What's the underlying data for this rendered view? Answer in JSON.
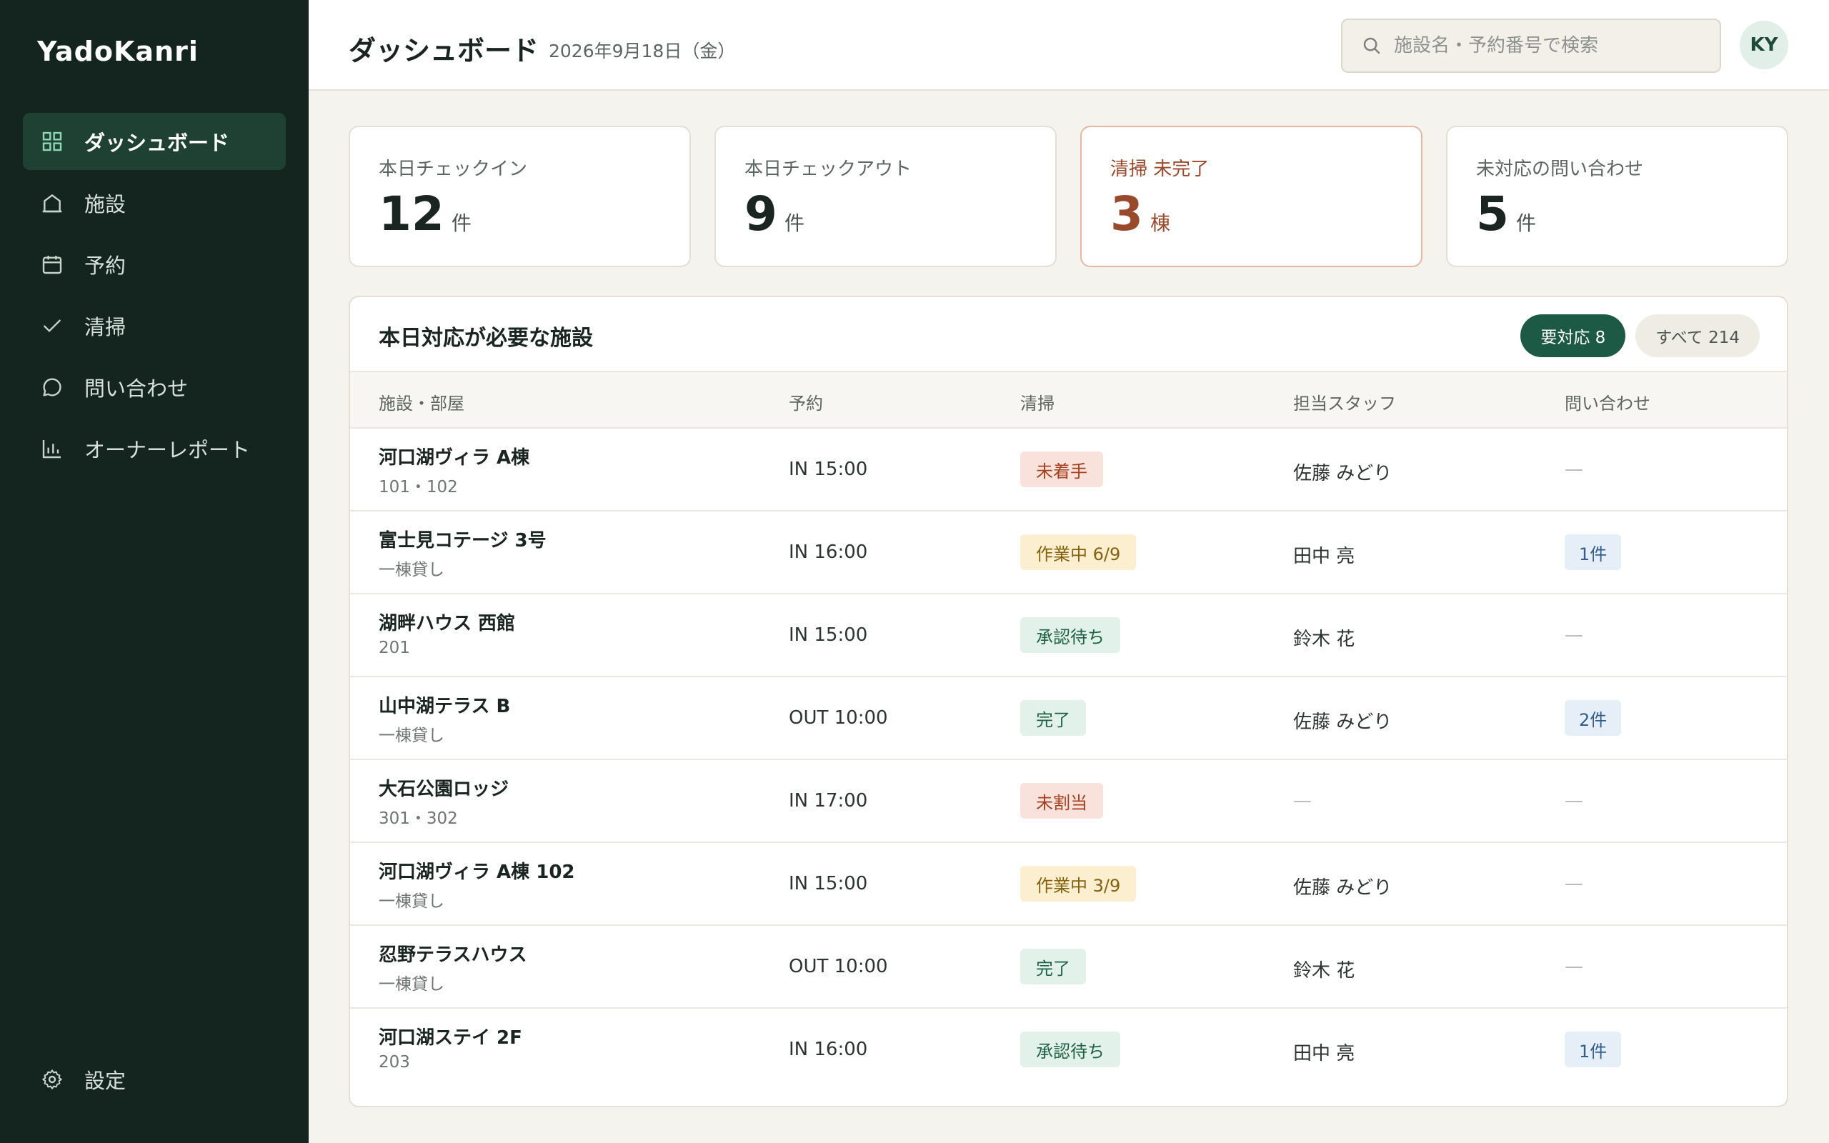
{
  "app": {
    "name": "YadoKanri"
  },
  "sidebar": {
    "items": [
      {
        "label": "ダッシュボード",
        "icon": "dashboard-icon",
        "active": true
      },
      {
        "label": "施設",
        "icon": "home-icon",
        "active": false
      },
      {
        "label": "予約",
        "icon": "calendar-icon",
        "active": false
      },
      {
        "label": "清掃",
        "icon": "check-icon",
        "active": false
      },
      {
        "label": "問い合わせ",
        "icon": "chat-icon",
        "active": false
      },
      {
        "label": "オーナーレポート",
        "icon": "bar-chart-icon",
        "active": false
      }
    ],
    "settings_label": "設定"
  },
  "header": {
    "title": "ダッシュボード",
    "date": "2026年9月18日（金）",
    "search_placeholder": "施設名・予約番号で検索",
    "avatar_initials": "KY"
  },
  "stats": [
    {
      "label": "本日チェックイン",
      "value": "12",
      "unit": "件",
      "alert": false
    },
    {
      "label": "本日チェックアウト",
      "value": "9",
      "unit": "件",
      "alert": false
    },
    {
      "label": "清掃 未完了",
      "value": "3",
      "unit": "棟",
      "alert": true
    },
    {
      "label": "未対応の問い合わせ",
      "value": "5",
      "unit": "件",
      "alert": false
    }
  ],
  "panel": {
    "title": "本日対応が必要な施設",
    "filters": {
      "active": "要対応 8",
      "all": "すべて 214"
    },
    "columns": [
      "施設・部屋",
      "予約",
      "清掃",
      "担当スタッフ",
      "問い合わせ"
    ],
    "rows": [
      {
        "name": "河口湖ヴィラ A棟",
        "sub": "101・102",
        "reserve": "IN 15:00",
        "cleaning": "未着手",
        "cleaning_tone": "red",
        "staff": "佐藤 みどり",
        "inquiry": "—"
      },
      {
        "name": "富士見コテージ 3号",
        "sub": "一棟貸し",
        "reserve": "IN 16:00",
        "cleaning": "作業中 6/9",
        "cleaning_tone": "yellow",
        "staff": "田中 亮",
        "inquiry": "1件"
      },
      {
        "name": "湖畔ハウス 西館",
        "sub": "201",
        "reserve": "IN 15:00",
        "cleaning": "承認待ち",
        "cleaning_tone": "green",
        "staff": "鈴木 花",
        "inquiry": "—"
      },
      {
        "name": "山中湖テラス B",
        "sub": "一棟貸し",
        "reserve": "OUT 10:00",
        "cleaning": "完了",
        "cleaning_tone": "green",
        "staff": "佐藤 みどり",
        "inquiry": "2件"
      },
      {
        "name": "大石公園ロッジ",
        "sub": "301・302",
        "reserve": "IN 17:00",
        "cleaning": "未割当",
        "cleaning_tone": "red",
        "staff": "—",
        "inquiry": "—"
      },
      {
        "name": "河口湖ヴィラ A棟 102",
        "sub": "一棟貸し",
        "reserve": "IN 15:00",
        "cleaning": "作業中 3/9",
        "cleaning_tone": "yellow",
        "staff": "佐藤 みどり",
        "inquiry": "—"
      },
      {
        "name": "忍野テラスハウス",
        "sub": "一棟貸し",
        "reserve": "OUT 10:00",
        "cleaning": "完了",
        "cleaning_tone": "green",
        "staff": "鈴木 花",
        "inquiry": "—"
      },
      {
        "name": "河口湖ステイ 2F",
        "sub": "203",
        "reserve": "IN 16:00",
        "cleaning": "承認待ち",
        "cleaning_tone": "green",
        "staff": "田中 亮",
        "inquiry": "1件"
      }
    ]
  },
  "colors": {
    "sidebar_bg": "#142520",
    "accent": "#1c5a45",
    "alert": "#9a4a2c",
    "background": "#f5f3ee"
  }
}
